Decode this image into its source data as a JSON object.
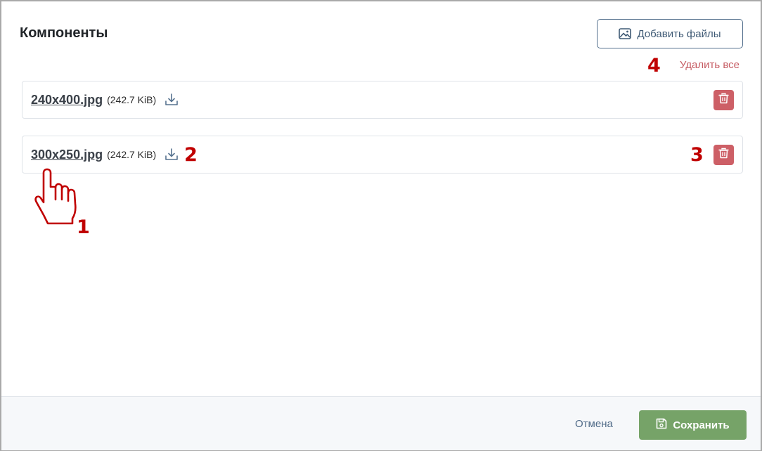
{
  "modal": {
    "title": "Компоненты"
  },
  "toolbar": {
    "add_files_label": "Добавить файлы",
    "add_files_icon": "image-icon",
    "delete_all_label": "Удалить все"
  },
  "files": [
    {
      "name": "240x400.jpg",
      "size": "(242.7 KiB)",
      "download_icon": "download-icon",
      "delete_icon": "trash-icon"
    },
    {
      "name": "300x250.jpg",
      "size": "(242.7 KiB)",
      "download_icon": "download-icon",
      "delete_icon": "trash-icon"
    }
  ],
  "annotations": {
    "marker_1": "1",
    "marker_2": "2",
    "marker_3": "3",
    "marker_4": "4",
    "pointer_icon": "hand-pointer-icon"
  },
  "footer": {
    "cancel_label": "Отмена",
    "save_label": "Сохранить",
    "save_icon": "floppy-disk-icon"
  },
  "colors": {
    "danger": "#cd5f66",
    "danger_text": "#c65c63",
    "success": "#76a368",
    "annotation": "#c00000",
    "primary_outline": "#56728f"
  }
}
